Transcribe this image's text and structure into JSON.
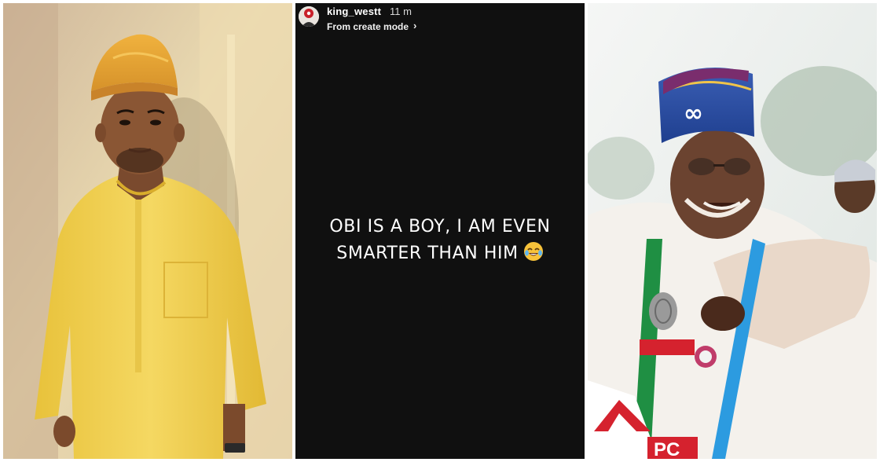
{
  "story": {
    "username": "king_westt",
    "time": "11 m",
    "subtitle": "From create mode",
    "text_line1": "OBI IS A BOY, I AM EVEN",
    "text_line2": "SMARTER THAN HIM",
    "emoji": "face-with-tears-of-joy-icon"
  },
  "right_photo": {
    "podium_letters": "PC"
  },
  "colors": {
    "story_background": "#101010",
    "left_outfit": "#f1cf4f",
    "cap_left": "#e9a632",
    "cap_right": "#2a56a9",
    "agbada_right": "#f4f1ec",
    "sash_green": "#1f8f43",
    "podium_red": "#d5222e"
  }
}
